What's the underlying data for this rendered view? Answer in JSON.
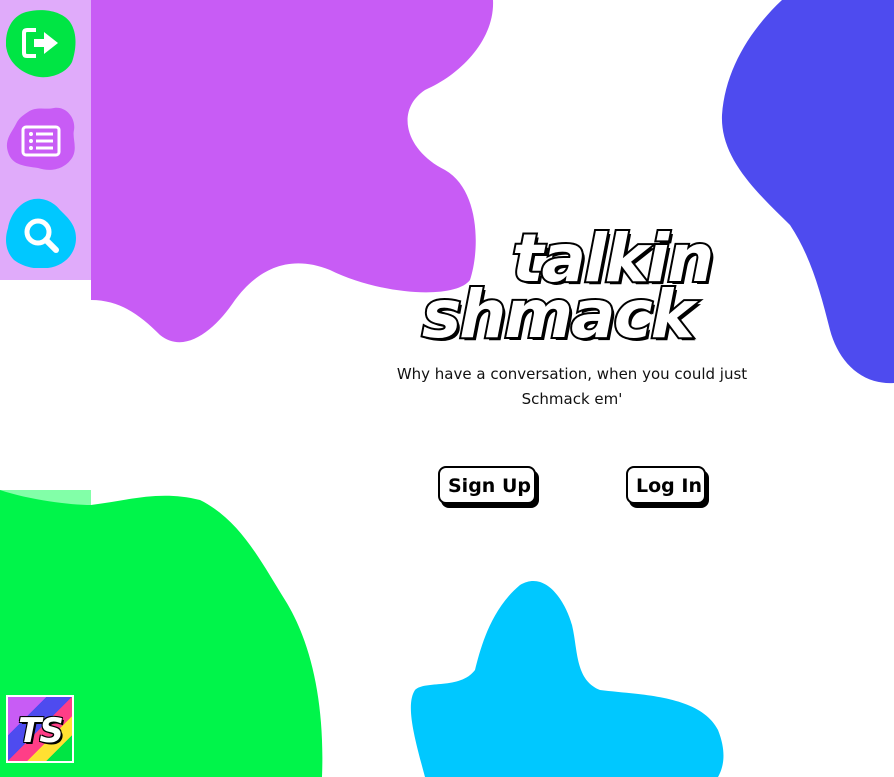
{
  "brand": {
    "line1": "talkin",
    "line2": "shmack",
    "tagline": "Why have a conversation, when you could just Schmack em'"
  },
  "auth": {
    "signup_label": "Sign Up",
    "login_label": "Log In"
  },
  "sidebar": {
    "items": [
      {
        "icon": "logout-icon",
        "color": "#00e544"
      },
      {
        "icon": "list-icon",
        "color": "#c85cf5"
      },
      {
        "icon": "search-icon",
        "color": "#00c8ff"
      }
    ],
    "logo_text": "TS"
  },
  "colors": {
    "purple": "#c85cf5",
    "indigo": "#4e4bef",
    "green": "#00f54a",
    "cyan": "#00c8ff",
    "sidebar_top": "#e0abfa",
    "sidebar_bottom": "#82ffa8"
  }
}
